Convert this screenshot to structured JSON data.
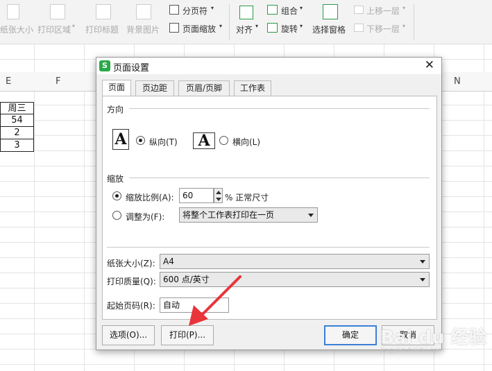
{
  "ribbon": {
    "paper_size": "纸张大小",
    "print_area": "打印区域",
    "print_titles": "打印标题",
    "background": "背景图片",
    "page_break": "分页符",
    "page_zoom": "页面缩放",
    "align": "对齐",
    "group": "组合",
    "rotate": "旋转",
    "selection_pane": "选择窗格",
    "bring_forward": "上移一层",
    "send_backward": "下移一层"
  },
  "sheet": {
    "columns": [
      "E",
      "F",
      "N"
    ],
    "cells": [
      "周三",
      "54",
      "2",
      "3"
    ]
  },
  "dialog": {
    "logo": "S",
    "title": "页面设置",
    "close": "✕",
    "tabs": [
      "页面",
      "页边距",
      "页眉/页脚",
      "工作表"
    ],
    "orientation_label": "方向",
    "portrait_label": "纵向(T)",
    "landscape_label": "横向(L)",
    "icon_letter": "A",
    "scale_label": "缩放",
    "scale_ratio_label": "缩放比例(A):",
    "scale_value": "60",
    "scale_suffix": "% 正常尺寸",
    "fit_label": "调整为(F):",
    "fit_value": "将整个工作表打印在一页",
    "paper_size_label": "纸张大小(Z):",
    "paper_size_value": "A4",
    "print_quality_label": "打印质量(Q):",
    "print_quality_value": "600 点/英寸",
    "first_page_label": "起始页码(R):",
    "first_page_value": "自动",
    "options_button": "选项(O)...",
    "print_button": "打印(P)...",
    "ok_button": "确定",
    "cancel_button": "取消"
  },
  "watermark": {
    "brand": "Bai du 经验",
    "url": "jingyan.baidu.com"
  },
  "colors": {
    "default_button_border": "#3c7fd8",
    "annotation_arrow": "#e8343a",
    "app_logo": "#2aa84a"
  }
}
